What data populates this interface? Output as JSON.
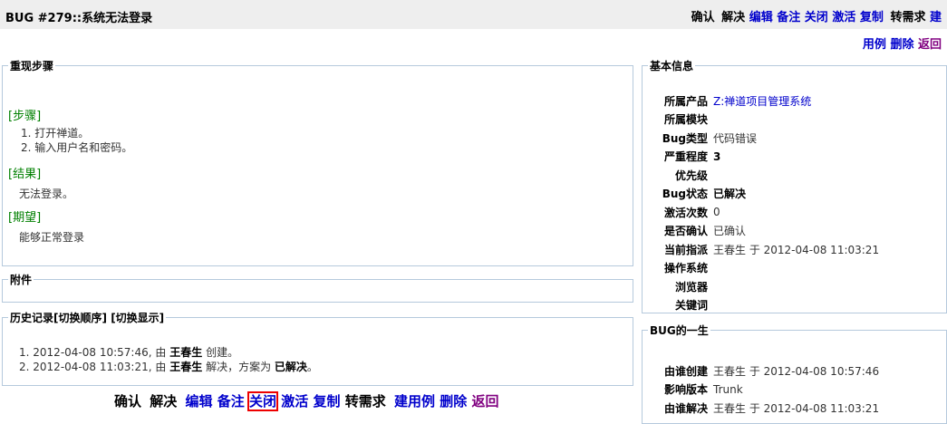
{
  "header": {
    "title": "BUG #279::系统无法登录",
    "actions": [
      "确认",
      "解决",
      "编辑",
      "备注",
      "关闭",
      "激活",
      "复制",
      "转需求",
      "建",
      "用例",
      "删除",
      "返回"
    ]
  },
  "steps": {
    "legend": "重现步骤",
    "step_label": "[步骤]",
    "steps": [
      "1. 打开禅道。",
      "2. 输入用户名和密码。"
    ],
    "result_label": "[结果]",
    "result": "无法登录。",
    "expect_label": "[期望]",
    "expect": "能够正常登录"
  },
  "attachments": {
    "legend": "附件"
  },
  "history": {
    "legend": "历史记录",
    "toggle_order": "[切换顺序]",
    "toggle_show": "[切换显示]",
    "items": [
      {
        "n": "1.",
        "time": "2012-04-08 10:57:46,",
        "by": "由",
        "user": "王春生",
        "action": "创建。",
        "extra": "",
        "tail": ""
      },
      {
        "n": "2.",
        "time": "2012-04-08 11:03:21,",
        "by": "由",
        "user": "王春生",
        "action": "解决，方案为",
        "extra": "已解决",
        "tail": "。"
      }
    ]
  },
  "basic": {
    "legend": "基本信息",
    "rows": [
      {
        "label": "所属产品",
        "value": "Z:禅道项目管理系统",
        "link": true
      },
      {
        "label": "所属模块",
        "value": ""
      },
      {
        "label": "Bug类型",
        "value": "代码错误"
      },
      {
        "label": "严重程度",
        "value": "3",
        "bold": true
      },
      {
        "label": "优先级",
        "value": ""
      },
      {
        "label": "Bug状态",
        "value": "已解决",
        "bold": true
      },
      {
        "label": "激活次数",
        "value": "0"
      },
      {
        "label": "是否确认",
        "value": "已确认"
      },
      {
        "label": "当前指派",
        "value": "王春生 于 2012-04-08 11:03:21"
      },
      {
        "label": "操作系统",
        "value": ""
      },
      {
        "label": "浏览器",
        "value": ""
      },
      {
        "label": "关键词",
        "value": ""
      }
    ]
  },
  "life": {
    "legend": "BUG的一生",
    "rows": [
      {
        "label": "由谁创建",
        "value": "王春生 于 2012-04-08 10:57:46"
      },
      {
        "label": "影响版本",
        "value": "Trunk"
      },
      {
        "label": "由谁解决",
        "value": "王春生 于 2012-04-08 11:03:21"
      }
    ]
  },
  "bottom": {
    "actions": [
      "确认",
      "解决",
      "编辑",
      "备注",
      "关闭",
      "激活",
      "复制",
      "转需求",
      "建用例",
      "删除",
      "返回"
    ]
  }
}
